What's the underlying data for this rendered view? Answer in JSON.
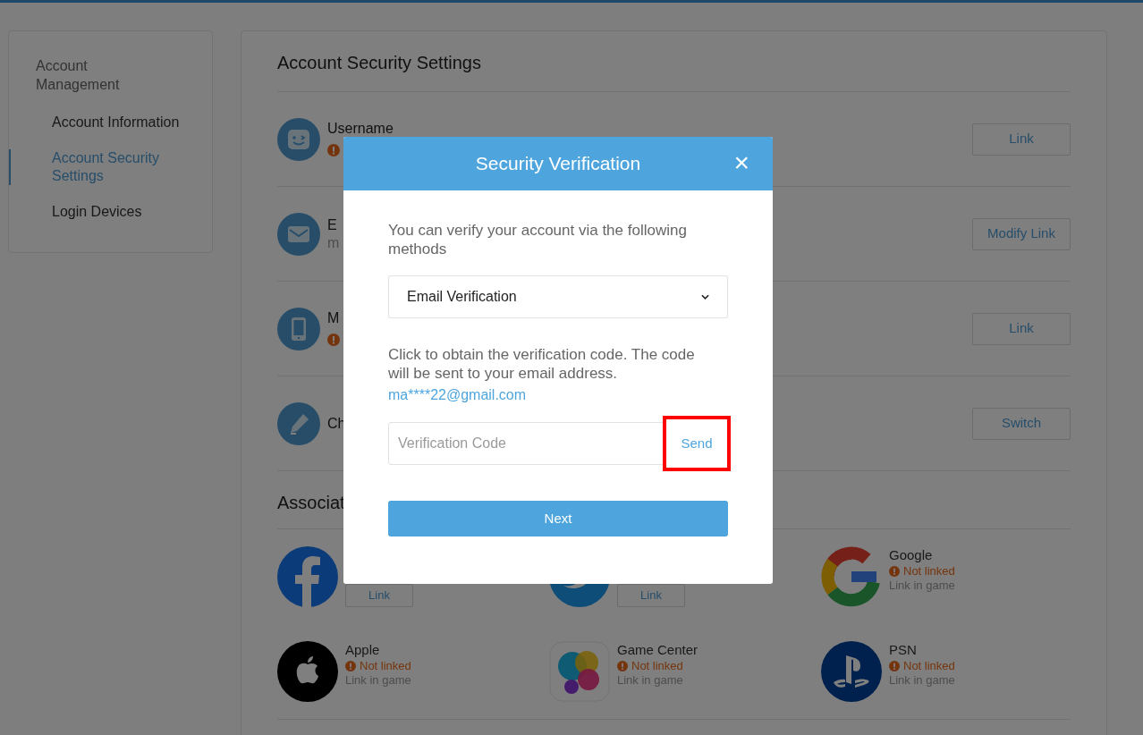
{
  "sidebar": {
    "heading": "Account Management",
    "items": [
      {
        "label": "Account Information",
        "selected": false
      },
      {
        "label": "Account Security Settings",
        "selected": true
      },
      {
        "label": "Login Devices",
        "selected": false
      }
    ]
  },
  "main": {
    "title": "Account Security Settings",
    "rows": [
      {
        "kind": "user",
        "label": "Username",
        "warning": true,
        "button": "Link"
      },
      {
        "kind": "email",
        "label": "E",
        "detail": "m",
        "warning": false,
        "button": "Modify Link"
      },
      {
        "kind": "phone",
        "label": "M",
        "warning": true,
        "button": "Link"
      },
      {
        "kind": "pencil",
        "label": "Ch",
        "warning": false,
        "button": "Switch"
      }
    ],
    "section_title": "Associat",
    "accounts": [
      {
        "kind": "facebook",
        "button": "Link"
      },
      {
        "kind": "twitter",
        "button": "Link"
      },
      {
        "kind": "google",
        "name": "Google",
        "status": "Not linked",
        "hint": "Link in game"
      },
      {
        "kind": "apple",
        "name": "Apple",
        "status": "Not linked",
        "hint": "Link in game"
      },
      {
        "kind": "gamecenter",
        "name": "Game Center",
        "status": "Not linked",
        "hint": "Link in game"
      },
      {
        "kind": "psn",
        "name": "PSN",
        "status": "Not linked",
        "hint": "Link in game"
      }
    ]
  },
  "dialog": {
    "title": "Security Verification",
    "close": "×",
    "intro": "You can verify your account via the following methods",
    "method": "Email Verification",
    "instructions": "Click to obtain the verification code. The code will be sent to your email address.",
    "email": "ma****22@gmail.com",
    "code_placeholder": "Verification Code",
    "send": {
      "label": "Send",
      "highlighted": true
    },
    "next": "Next"
  }
}
